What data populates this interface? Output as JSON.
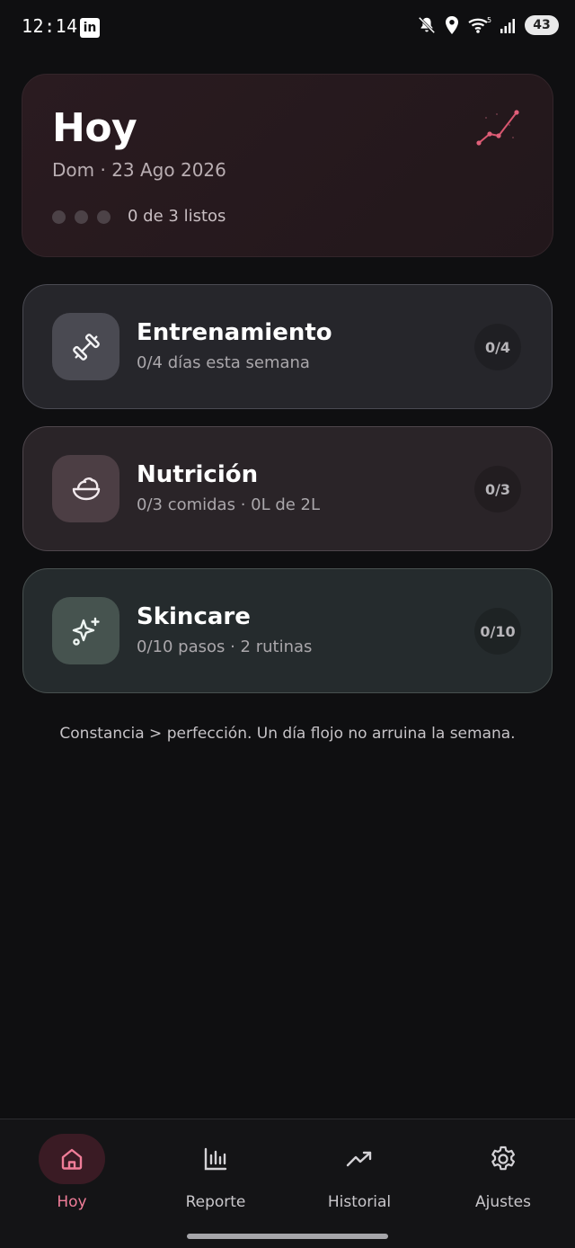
{
  "status_bar": {
    "time": "12:14",
    "notification_app": "in",
    "battery": "43"
  },
  "hero": {
    "title": "Hoy",
    "date": "Dom · 23 Ago 2026",
    "progress": "0 de 3 listos"
  },
  "cards": [
    {
      "title": "Entrenamiento",
      "subtitle": "0/4 días esta semana",
      "badge": "0/4",
      "icon": "dumbbell-icon"
    },
    {
      "title": "Nutrición",
      "subtitle": "0/3 comidas · 0L de 2L",
      "badge": "0/3",
      "icon": "salad-bowl-icon"
    },
    {
      "title": "Skincare",
      "subtitle": "0/10 pasos · 2 rutinas",
      "badge": "0/10",
      "icon": "sparkles-icon"
    }
  ],
  "motto": "Constancia > perfección. Un día flojo no arruina la semana.",
  "nav": [
    {
      "label": "Hoy",
      "icon": "home-icon",
      "active": true
    },
    {
      "label": "Reporte",
      "icon": "bar-chart-icon",
      "active": false
    },
    {
      "label": "Historial",
      "icon": "trending-up-icon",
      "active": false
    },
    {
      "label": "Ajustes",
      "icon": "gear-icon",
      "active": false
    }
  ],
  "colors": {
    "accent": "#f07d98",
    "background": "#0f0f11"
  }
}
